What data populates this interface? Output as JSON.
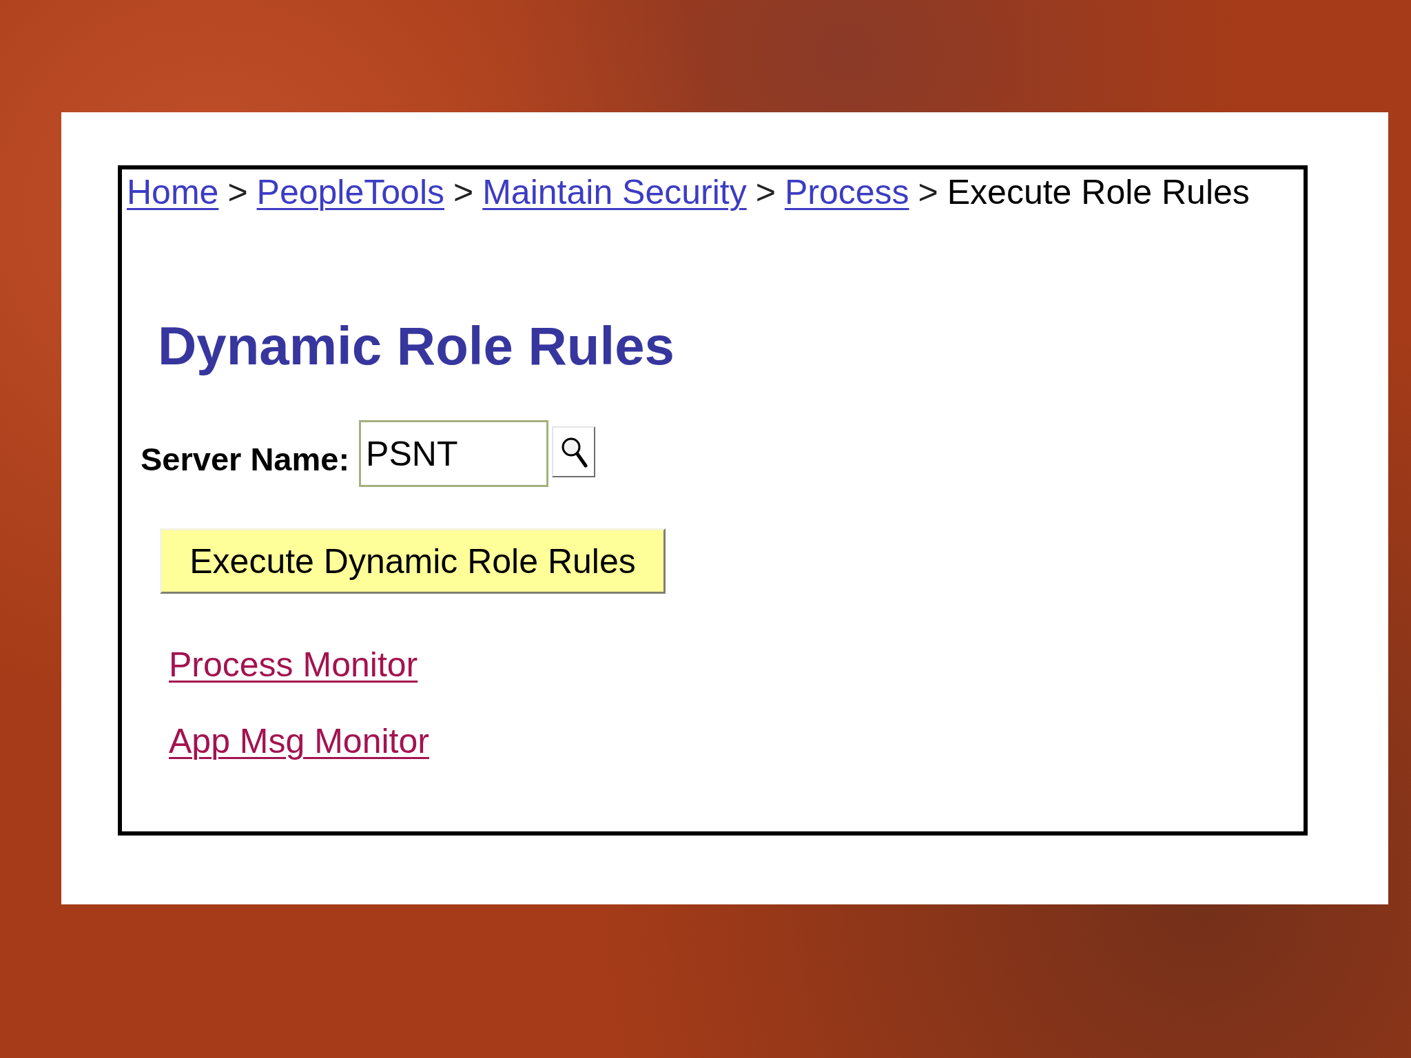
{
  "breadcrumb": [
    {
      "label": "Home",
      "kind": "link"
    },
    {
      "label": "PeopleTools",
      "kind": "link",
      "separator": ">"
    },
    {
      "label": "Maintain Security",
      "kind": "link",
      "separator": ">"
    },
    {
      "label": "Process",
      "kind": "link",
      "separator": ">"
    },
    {
      "label": "Execute Role Rules",
      "kind": "current",
      "separator": ">"
    }
  ],
  "page_title": "Dynamic Role Rules",
  "server_name": {
    "label": "Server Name:",
    "value": "PSNT"
  },
  "execute_button": {
    "label": "Execute Dynamic Role Rules"
  },
  "links": [
    {
      "label": "Process Monitor"
    },
    {
      "label": "App Msg Monitor"
    }
  ]
}
